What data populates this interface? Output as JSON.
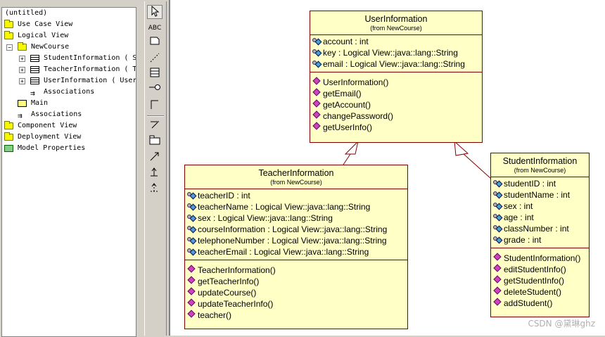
{
  "browser": {
    "root": "(untitled)",
    "items": [
      {
        "label": "Use Case View"
      },
      {
        "label": "Logical View"
      },
      {
        "label": "NewCourse"
      },
      {
        "label": "StudentInformation ( S"
      },
      {
        "label": "TeacherInformation ( T"
      },
      {
        "label": "UserInformation ( User"
      },
      {
        "label": "Associations"
      },
      {
        "label": "Main"
      },
      {
        "label": "Associations"
      },
      {
        "label": "Component View"
      },
      {
        "label": "Deployment View"
      },
      {
        "label": "Model Properties"
      }
    ]
  },
  "toolbar": {
    "text_tool": "ABC"
  },
  "classes": {
    "user": {
      "name": "UserInformation",
      "from": "(from NewCourse)",
      "attributes": [
        "account : int",
        "key : Logical View::java::lang::String",
        "email : Logical View::java::lang::String"
      ],
      "operations": [
        "UserInformation()",
        "getEmail()",
        "getAccount()",
        "changePassword()",
        "getUserInfo()"
      ]
    },
    "teacher": {
      "name": "TeacherInformation",
      "from": "(from NewCourse)",
      "attributes": [
        "teacherID : int",
        "teacherName : Logical View::java::lang::String",
        "sex : Logical View::java::lang::String",
        "courseInformation : Logical View::java::lang::String",
        "telephoneNumber : Logical View::java::lang::String",
        "teacherEmail : Logical View::java::lang::String"
      ],
      "operations": [
        "TeacherInformation()",
        "getTeacherInfo()",
        "updateCourse()",
        "updateTeacherInfo()",
        "teacher()"
      ]
    },
    "student": {
      "name": "StudentInformation",
      "from": "(from NewCourse)",
      "attributes": [
        "studentID : int",
        "studentName : int",
        "sex : int",
        "age : int",
        "classNumber : int",
        "grade : int"
      ],
      "operations": [
        "StudentInformation()",
        "editStudentInfo()",
        "getStudentInfo()",
        "deleteStudent()",
        "addStudent()"
      ]
    }
  },
  "watermark": "CSDN @黛琳ghz",
  "colors": {
    "class_fill": "#ffffc6",
    "class_border": "#800000",
    "attribute_icon": "#4aa0d8",
    "operation_icon": "#d040c0"
  }
}
